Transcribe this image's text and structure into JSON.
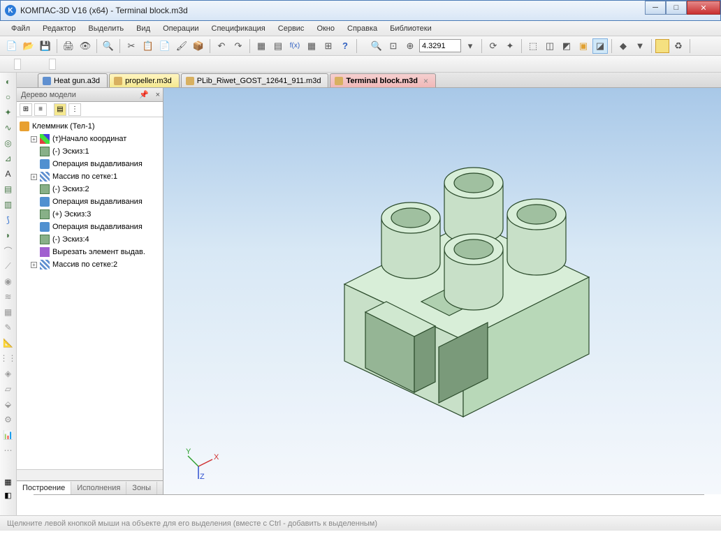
{
  "title": "КОМПАС-3D V16  (x64) - Terminal block.m3d",
  "menu": {
    "file": "Файл",
    "editor": "Редактор",
    "select": "Выделить",
    "view": "Вид",
    "operations": "Операции",
    "spec": "Спецификация",
    "service": "Сервис",
    "window": "Окно",
    "help": "Справка",
    "libs": "Библиотеки"
  },
  "toolbar": {
    "zoom_value": "4.3291"
  },
  "tabs": [
    {
      "label": "Heat gun.a3d",
      "cls": ""
    },
    {
      "label": "propeller.m3d",
      "cls": "yellow"
    },
    {
      "label": "PLib_Riwet_GOST_12641_911.m3d",
      "cls": ""
    },
    {
      "label": "Terminal block.m3d",
      "cls": "pink",
      "closable": true,
      "active": true
    }
  ],
  "tree": {
    "title": "Дерево модели",
    "root": "Клеммник (Тел-1)",
    "items": [
      {
        "exp": "+",
        "icon": "ic-axis",
        "label": "(т)Начало координат"
      },
      {
        "exp": "",
        "icon": "ic-sketch",
        "label": "(-) Эскиз:1"
      },
      {
        "exp": "",
        "icon": "ic-extrude",
        "label": "Операция выдавливания"
      },
      {
        "exp": "+",
        "icon": "ic-array",
        "label": "Массив по сетке:1"
      },
      {
        "exp": "",
        "icon": "ic-sketch",
        "label": "(-) Эскиз:2"
      },
      {
        "exp": "",
        "icon": "ic-extrude",
        "label": "Операция выдавливания"
      },
      {
        "exp": "",
        "icon": "ic-sketch",
        "label": "(+) Эскиз:3"
      },
      {
        "exp": "",
        "icon": "ic-extrude",
        "label": "Операция выдавливания"
      },
      {
        "exp": "",
        "icon": "ic-sketch",
        "label": "(-) Эскиз:4"
      },
      {
        "exp": "",
        "icon": "ic-cut",
        "label": "Вырезать элемент выдав."
      },
      {
        "exp": "+",
        "icon": "ic-array",
        "label": "Массив по сетке:2"
      }
    ],
    "bottom_tabs": {
      "build": "Построение",
      "exec": "Исполнения",
      "zones": "Зоны"
    }
  },
  "status": "Щелкните левой кнопкой мыши на объекте для его выделения (вместе с Ctrl - добавить к выделенным)"
}
